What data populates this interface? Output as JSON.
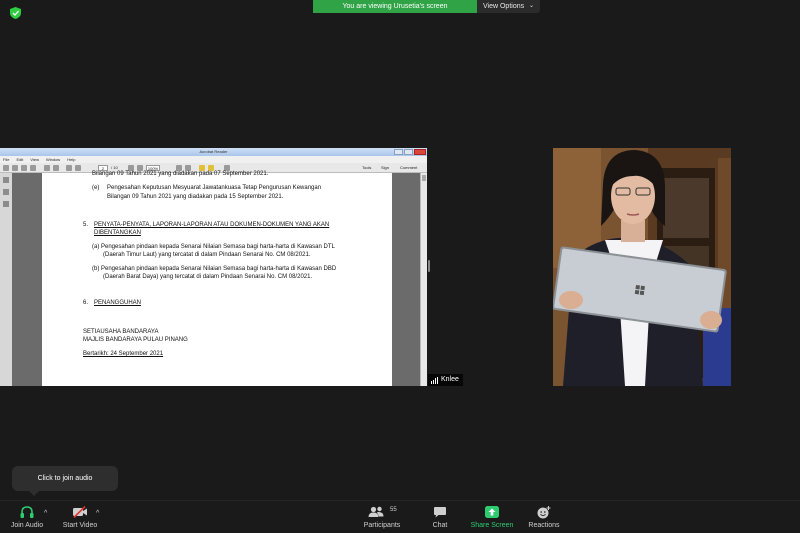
{
  "top_bar": {
    "banner_text": "You are viewing Urusetia's screen",
    "view_options_label": "View Options",
    "security_icon": "shield-check-icon",
    "accent": "#31a347"
  },
  "shared_screen": {
    "app_title": "Acrobat Reader",
    "menu": [
      "File",
      "Edit",
      "View",
      "Window",
      "Help"
    ],
    "toolbar": {
      "page_current": "2",
      "page_total": "/ 10",
      "zoom": "100%",
      "tools_label": "Tools",
      "sign_label": "Sign",
      "comment_label": "Comment"
    },
    "doc": {
      "top_cut": "Bilangan 09 Tahun 2021  yang diadakan pada 07 September 2021.",
      "item_e_letter": "(e)",
      "item_e_line1": "Pengesahan Keputusan Mesyuarat Jawatankuasa Tetap Pengurusan Kewangan",
      "item_e_line2": "Bilangan 09 Tahun 2021 yang diadakan pada 15 September 2021.",
      "sec5_num": "5.",
      "sec5_title1": "PENYATA-PENYATA, LAPORAN-LAPORAN ATAU DOKUMEN-DOKUMEN YANG AKAN",
      "sec5_title2": "DIBENTANGKAN",
      "item_a_line1": "(a)  Pengesahan pindaan kepada Senarai Nilaian Semasa bagi harta-harta di Kawasan DTL",
      "item_a_line2": "(Daerah Timur Laut)  yang tercatat di dalam Pindaan Senarai  No. CM 08/2021.",
      "item_b_line1": "(b)  Pengesahan pindaan kepada Senarai Nilaian Semasa bagi harta-harta di Kawasan DBD",
      "item_b_line2": "(Daerah Barat Daya) yang tercatat di dalam Pindaan Senarai No. CM 08/2021.",
      "sec6_num": "6.",
      "sec6_title": "PENANGGUHAN",
      "sign_line1": "SETIAUSAHA BANDARAYA",
      "sign_line2": "MAJLIS BANDARAYA PULAU PINANG",
      "date_line": "Bertarikh:  24 September 2021"
    }
  },
  "video": {
    "participant_name": "Knlee"
  },
  "tooltip": {
    "text": "Click to join audio"
  },
  "bottom_bar": {
    "join_audio": "Join Audio",
    "start_video": "Start Video",
    "participants": "Participants",
    "participants_count": "55",
    "chat": "Chat",
    "share_screen": "Share Screen",
    "reactions": "Reactions"
  }
}
